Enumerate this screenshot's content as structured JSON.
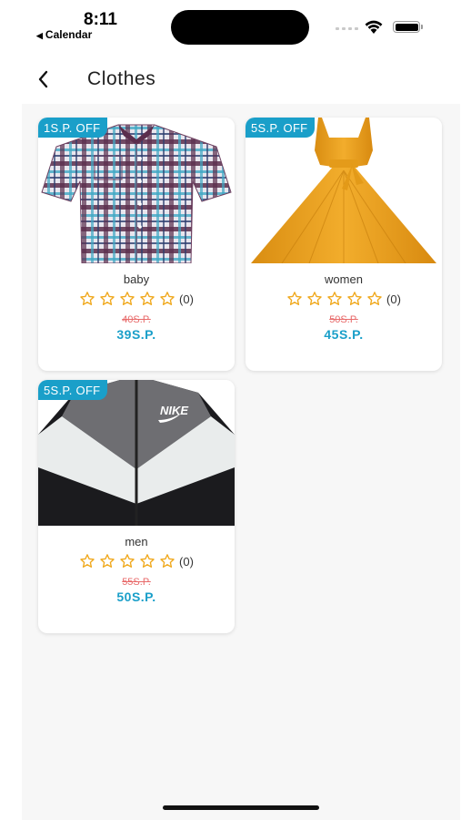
{
  "status_bar": {
    "time": "8:11",
    "back_app_label": "Calendar"
  },
  "header": {
    "title": "Clothes"
  },
  "products": [
    {
      "discount_badge": "1S.P. OFF",
      "name": "baby",
      "rating_stars": 0,
      "rating_count": "(0)",
      "old_price": "40S.P.",
      "new_price": "39S.P.",
      "image": "plaid-shirt"
    },
    {
      "discount_badge": "5S.P. OFF",
      "name": "women",
      "rating_stars": 0,
      "rating_count": "(0)",
      "old_price": "50S.P.",
      "new_price": "45S.P.",
      "image": "yellow-dress"
    },
    {
      "discount_badge": "5S.P. OFF",
      "name": "men",
      "rating_stars": 0,
      "rating_count": "(0)",
      "old_price": "55S.P.",
      "new_price": "50S.P.",
      "image": "nike-jacket",
      "image_brand_text": "NIKE"
    }
  ],
  "colors": {
    "accent": "#1a9fc9",
    "old_price": "#e86a6a",
    "star": "#f0a81c",
    "background": "#f7f7f7"
  }
}
